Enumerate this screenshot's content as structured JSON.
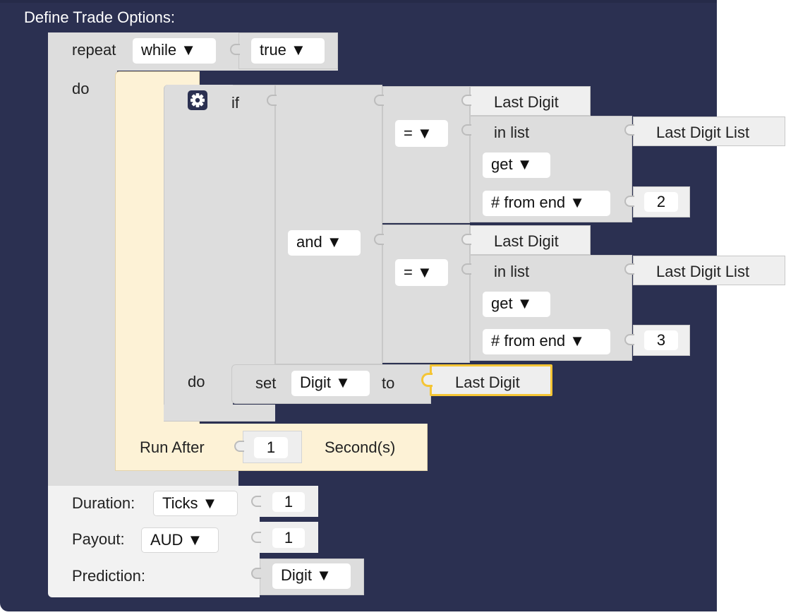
{
  "header": {
    "title": "Define Trade Options:"
  },
  "repeat_block": {
    "label": "repeat",
    "mode": "while ▼",
    "condition": "true ▼",
    "do_label": "do"
  },
  "if_block": {
    "if_label": "if",
    "do_label": "do",
    "gear_icon": "gear-icon",
    "logic_op": "and ▼",
    "compare1": {
      "op": "= ▼",
      "left": "Last Digit",
      "in_list": "in list",
      "list_name": "Last Digit List",
      "get": "get ▼",
      "from": "# from end ▼",
      "index": "2"
    },
    "compare2": {
      "op": "= ▼",
      "left": "Last Digit",
      "in_list": "in list",
      "list_name": "Last Digit List",
      "get": "get ▼",
      "from": "# from end ▼",
      "index": "3"
    },
    "set_stmt": {
      "set_label": "set",
      "variable": "Digit ▼",
      "to_label": "to",
      "value": "Last Digit"
    }
  },
  "run_after": {
    "label": "Run After",
    "value": "1",
    "unit": "Second(s)"
  },
  "trade_options": {
    "duration_label": "Duration:",
    "duration_unit": "Ticks ▼",
    "duration_value": "1",
    "payout_label": "Payout:",
    "payout_currency": "AUD ▼",
    "payout_value": "1",
    "prediction_label": "Prediction:",
    "prediction_value": "Digit ▼"
  },
  "colors": {
    "outer": "#2b3051",
    "block": "#dddddd",
    "block_light": "#efefef",
    "run_after": "#fdf2d6",
    "highlight": "#f5c535"
  }
}
